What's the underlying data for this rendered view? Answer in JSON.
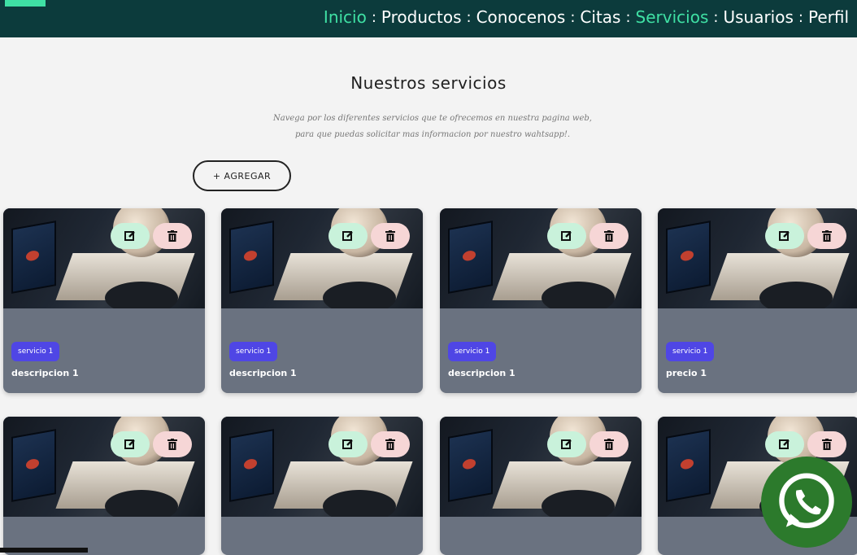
{
  "nav": {
    "items": [
      {
        "label": "Inicio",
        "active": true
      },
      {
        "label": "Productos",
        "active": false
      },
      {
        "label": "Conocenos",
        "active": false
      },
      {
        "label": "Citas",
        "active": false
      },
      {
        "label": "Servicios",
        "active": true
      },
      {
        "label": "Usuarios",
        "active": false
      },
      {
        "label": "Perfil",
        "active": false
      }
    ],
    "separator": ":"
  },
  "page": {
    "title": "Nuestros servicios",
    "subtitle": "Navega por los diferentes servicios que te ofrecemos en nuestra pagina web, para que puedas solicitar mas informacion por nuestro wahtsapp!.",
    "add_label": "+ AGREGAR"
  },
  "cards": [
    {
      "badge": "servicio 1",
      "text": "descripcion 1"
    },
    {
      "badge": "servicio 1",
      "text": "descripcion 1"
    },
    {
      "badge": "servicio 1",
      "text": "descripcion 1"
    },
    {
      "badge": "servicio 1",
      "text": "precio 1"
    },
    {
      "badge": "",
      "text": ""
    },
    {
      "badge": "",
      "text": ""
    },
    {
      "badge": "",
      "text": ""
    },
    {
      "badge": "",
      "text": ""
    }
  ],
  "colors": {
    "navbar": "#0c3b3c",
    "nav_active": "#3fe0a4",
    "card_body": "#6a7280",
    "badge": "#4f46e5",
    "edit": "#c9f2db",
    "delete": "#f6d6d6",
    "whatsapp": "#2c7a2c"
  },
  "icons": {
    "edit": "edit-icon",
    "delete": "trash-icon",
    "whatsapp": "whatsapp-icon"
  }
}
